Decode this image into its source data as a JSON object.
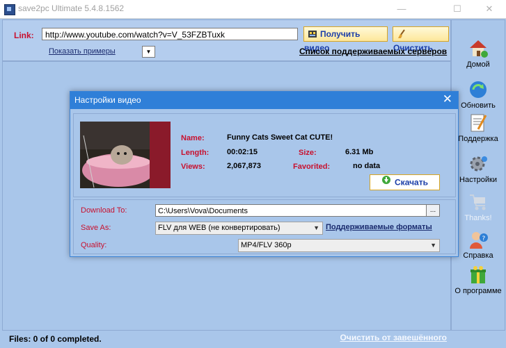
{
  "window": {
    "title": "save2pc Ultimate  5.4.8.1562",
    "minimize_glyph": "—",
    "maximize_glyph": "☐",
    "close_glyph": "✕"
  },
  "top": {
    "link_label": "Link:",
    "link_value": "http://www.youtube.com/watch?v=V_53FZBTuxk",
    "get_video_label": "Получить видео",
    "clear_label": "Очистить",
    "examples_label": "Показать примеры",
    "servers_label": "Список поддерживаемых серверов"
  },
  "status": {
    "files_text": "Files: 0 of 0 completed.",
    "clear_completed_label": "Очистить от завешённого"
  },
  "sidebar": {
    "items": [
      {
        "label": "Домой",
        "icon": "home-icon"
      },
      {
        "label": "Обновить",
        "icon": "refresh-icon"
      },
      {
        "label": "Поддержка",
        "icon": "support-icon"
      },
      {
        "label": "Настройки",
        "icon": "settings-icon"
      },
      {
        "label": "Thanks!",
        "icon": "cart-icon"
      },
      {
        "label": "Справка",
        "icon": "help-icon"
      },
      {
        "label": "О программе",
        "icon": "about-icon"
      }
    ]
  },
  "dialog": {
    "title": "Настройки видео",
    "close_glyph": "✕",
    "info": {
      "name_label": "Name:",
      "name_value": "Funny Cats Sweet Cat  CUTE!",
      "length_label": "Length:",
      "length_value": "00:02:15",
      "size_label": "Size:",
      "size_value": "6.31 Mb",
      "views_label": "Views:",
      "views_value": "2,067,873",
      "favorited_label": "Favorited:",
      "favorited_value": "no data",
      "download_label": "Скачать"
    },
    "options": {
      "download_to_label": "Download To:",
      "download_to_value": "C:\\Users\\Vova\\Documents",
      "browse_label": "...",
      "save_as_label": "Save As:",
      "save_as_value": "FLV для WEB (не конвертировать)",
      "formats_link": "Поддерживаемые форматы",
      "quality_label": "Quality:",
      "quality_value": "MP4/FLV 360p"
    }
  },
  "colors": {
    "background": "#a9c6ea",
    "label_red": "#c8102e",
    "dialog_title": "#2f7fd8",
    "link_blue": "#1a3da8"
  }
}
